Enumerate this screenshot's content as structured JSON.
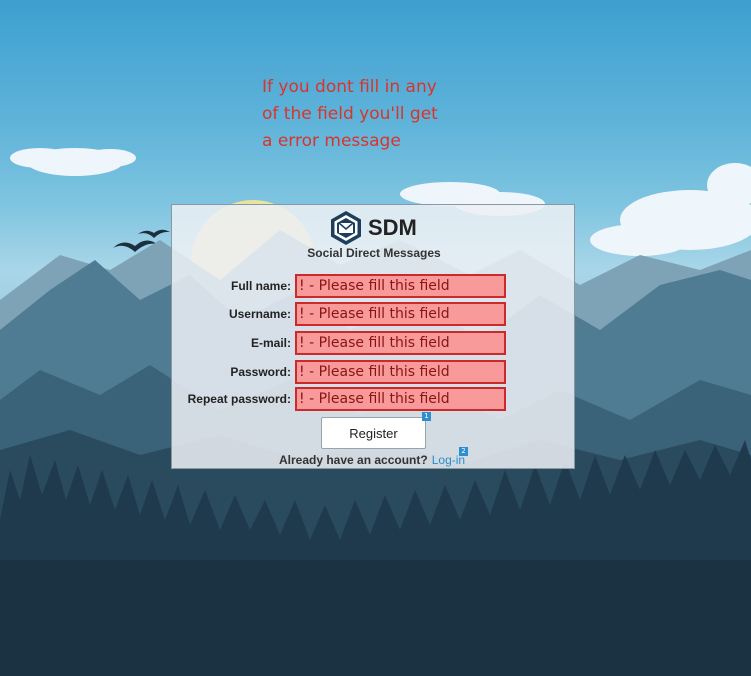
{
  "annotation": {
    "lines": [
      "If you dont fill in any",
      "of the field you'll get",
      "a error message"
    ],
    "color": "#d9342c"
  },
  "brand": {
    "logo_icon": "envelope-logo-icon",
    "name": "SDM",
    "subtitle": "Social Direct Messages"
  },
  "form": {
    "fields": [
      {
        "label": "Full name:",
        "placeholder": "! - Please fill this field"
      },
      {
        "label": "Username:",
        "placeholder": "! - Please fill this field"
      },
      {
        "label": "E-mail:",
        "placeholder": "! - Please fill this field"
      },
      {
        "label": "Password:",
        "placeholder": "! - Please fill this field"
      },
      {
        "label": "Repeat password:",
        "placeholder": "! - Please fill this field"
      }
    ],
    "error_colors": {
      "background": "#f99a9a",
      "border": "#cc2a2a",
      "text": "#8a1313"
    },
    "register_label": "Register",
    "register_badge": "1",
    "account_text": "Already have an account?",
    "login_label": "Log-in",
    "login_badge": "2",
    "link_color": "#2b8ec9"
  }
}
